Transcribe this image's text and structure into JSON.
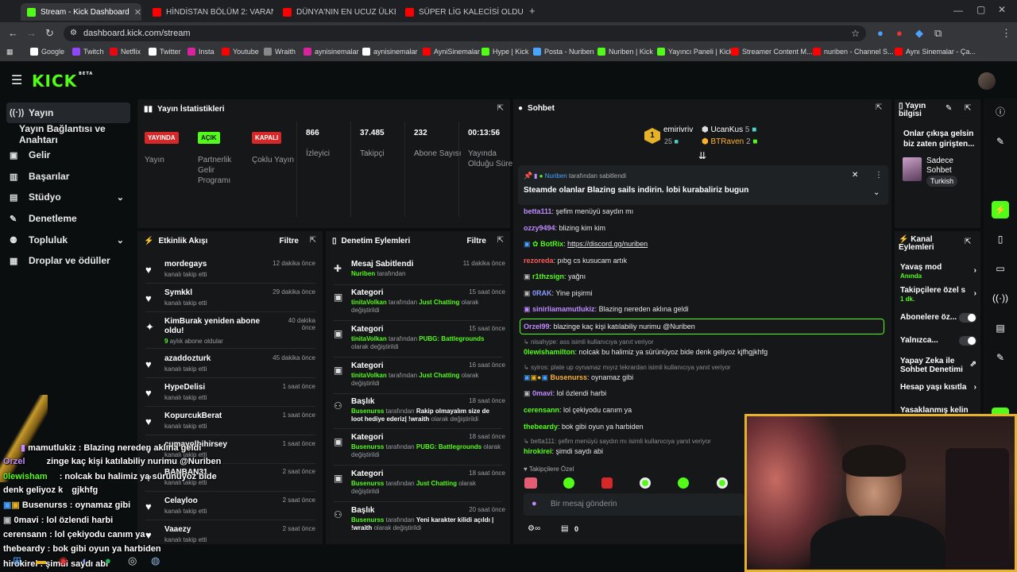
{
  "browser": {
    "tabs": [
      {
        "title": "Stream - Kick Dashboard",
        "active": true
      },
      {
        "title": "HİNDİSTAN BÖLÜM 2: VARANA",
        "active": false
      },
      {
        "title": "DÜNYA'NIN EN UCUZ ÜLKESİ V",
        "active": false
      },
      {
        "title": "SÜPER LİG KALECİSİ OLDUM ! |",
        "active": false
      }
    ],
    "url": "dashboard.kick.com/stream",
    "bookmarks": [
      "Google",
      "Twitch",
      "Netflix",
      "Twitter",
      "Insta",
      "Youtube",
      "Wraith",
      "aynisinemalar",
      "aynisinemalar",
      "AyniSinemalar",
      "Hype | Kick",
      "Posta - Nuriben",
      "Nuriben | Kick",
      "Yayıncı Paneli | Kick",
      "Streamer Content M...",
      "nuriben - Channel S...",
      "Aynı Sinemalar - Ça..."
    ]
  },
  "brand": {
    "logo": "KICK",
    "beta": "BETA",
    "accent": "#53fc18"
  },
  "sidebar": {
    "items": [
      {
        "label": "Yayın",
        "icon": "broadcast-icon"
      },
      {
        "label": "Yayın Bağlantısı ve Anahtarı"
      },
      {
        "label": "Gelir",
        "icon": "money-icon"
      },
      {
        "label": "Başarılar",
        "icon": "trophy-icon"
      },
      {
        "label": "Stüdyo",
        "icon": "studio-icon"
      },
      {
        "label": "Denetleme",
        "icon": "wrench-icon"
      },
      {
        "label": "Topluluk",
        "icon": "community-icon"
      },
      {
        "label": "Droplar ve ödüller",
        "icon": "gift-icon"
      }
    ]
  },
  "stats": {
    "title": "Yayın İstatistikleri",
    "items": [
      {
        "badge": "YAYINDA",
        "label": "Yayın"
      },
      {
        "badge": "AÇIK",
        "label": "Partnerlik Gelir Programı"
      },
      {
        "badge": "KAPALI",
        "label": "Çoklu Yayın"
      },
      {
        "value": "866",
        "label": "İzleyici"
      },
      {
        "value": "37.485",
        "label": "Takipçi"
      },
      {
        "value": "232",
        "label": "Abone Sayısı"
      },
      {
        "value": "00:13:56",
        "label": "Yayında Olduğu Süre"
      }
    ]
  },
  "activity": {
    "title": "Etkinlik Akışı",
    "filter": "Filtre",
    "items": [
      {
        "name": "mordegays",
        "sub": "kanalı takip etti",
        "time": "12 dakika önce"
      },
      {
        "name": "Symkkl",
        "sub": "kanalı takip etti",
        "time": "29 dakika önce"
      },
      {
        "name": "KimBurak yeniden abone oldu!",
        "sub_num": "9",
        "sub": "aylık abone oldular",
        "time": "40 dakika önce"
      },
      {
        "name": "azaddozturk",
        "sub": "kanalı takip etti",
        "time": "45 dakika önce"
      },
      {
        "name": "HypeDelisi",
        "sub": "kanalı takip etti",
        "time": "1 saat önce"
      },
      {
        "name": "KopurcukBerat",
        "sub": "kanalı takip etti",
        "time": "1 saat önce"
      },
      {
        "name": "cumayolbihirsey",
        "sub": "kanalı takip etti",
        "time": "1 saat önce"
      },
      {
        "name": "BANBAN31",
        "sub": "kanalı takip etti",
        "time": "2 saat önce"
      },
      {
        "name": "Celayloo",
        "sub": "kanalı takip etti",
        "time": "2 saat önce"
      },
      {
        "name": "Vaaezy",
        "sub": "kanalı takip etti",
        "time": "2 saat önce"
      }
    ]
  },
  "modactions": {
    "title": "Denetim Eylemleri",
    "filter": "Filtre",
    "items": [
      {
        "title": "Mesaj Sabitlendi",
        "time": "11 dakika önce",
        "user": "Nuriben",
        "mid": "tarafından",
        "rest": ""
      },
      {
        "title": "Kategori",
        "time": "15 saat önce",
        "user": "tinitaVolkan",
        "mid": "tarafından",
        "target": "Just Chatting",
        "rest": "olarak değiştirildi"
      },
      {
        "title": "Kategori",
        "time": "15 saat önce",
        "user": "tinitaVolkan",
        "mid": "tarafından",
        "target": "PUBG: Battlegrounds",
        "rest": "olarak değiştirildi"
      },
      {
        "title": "Kategori",
        "time": "16 saat önce",
        "user": "tinitaVolkan",
        "mid": "tarafından",
        "target": "Just Chatting",
        "rest": "olarak değiştirildi"
      },
      {
        "title": "Başlık",
        "time": "18 saat önce",
        "user": "Busenurss",
        "mid": "tarafından",
        "target": "Rakip olmayalım size de loot hediye ederiz| !wraith",
        "rest": "olarak değiştirildi"
      },
      {
        "title": "Kategori",
        "time": "18 saat önce",
        "user": "Busenurss",
        "mid": "tarafından",
        "target": "PUBG: Battlegrounds",
        "rest": "olarak değiştirildi"
      },
      {
        "title": "Kategori",
        "time": "18 saat önce",
        "user": "Busenurss",
        "mid": "tarafından",
        "target": "Just Chatting",
        "rest": "olarak değiştirildi"
      },
      {
        "title": "Başlık",
        "time": "20 saat önce",
        "user": "Busenurss",
        "mid": "tarafından",
        "target": "Yeni karakter kilidi açıldı | !wraith",
        "rest": "olarak değiştirildi"
      }
    ]
  },
  "chat": {
    "title": "Sohbet",
    "leaders": [
      {
        "rank": "1",
        "name": "emirivriv",
        "count": "25"
      },
      {
        "name": "UcanKus",
        "count": "5"
      },
      {
        "name": "BTRaven",
        "count": "2"
      }
    ],
    "pinned": {
      "by_user": "Nuriben",
      "by_text": "tarafından sabitlendi",
      "message": "Steamde olanlar Blazing sails indirin. lobi kurabaliriz bugun"
    },
    "messages": [
      {
        "user": "betta111",
        "color": "#c08cff",
        "text": "şefim menüyü saydın mı"
      },
      {
        "user": "ozzy9494",
        "color": "#c08cff",
        "text": "blizing kim kim"
      },
      {
        "user": "BotRix",
        "color": "#53fc18",
        "text": "https://discord.gg/nuriben"
      },
      {
        "user": "rezoreda",
        "color": "#ff5a5a",
        "text": "pıbg cs kusucam artık"
      },
      {
        "user": "r1thzsign",
        "color": "#53fc18",
        "text": "yağnı"
      },
      {
        "user": "0RAK",
        "color": "#8a9cff",
        "text": "Yine pişirmi"
      },
      {
        "user": "sinirliamamutlukiz",
        "color": "#c08cff",
        "text": "Blazing nereden aklına geldi"
      },
      {
        "user": "Orzel99",
        "color": "#c08cff",
        "text": "blazinge kaç kişi katılabiliy nurimu @Nuriben"
      },
      {
        "sys": "nisahype: ass isimli kullanıcıya yanıt veriyor"
      },
      {
        "user": "0lewishamilton",
        "color": "#53fc18",
        "text": "nolcak bu halimiz ya sürünüyoz bide denk geliyoz kjfhgjkhfg"
      },
      {
        "sys": "syiros: plate up oynamaz mıyız tekrardan isimli kullanıcıya yanıt veriyor"
      },
      {
        "user": "Busenurss",
        "color": "#ffb02e",
        "text": "oynamaz gibi"
      },
      {
        "user": "0mavi",
        "color": "#c08cff",
        "text": "lol özlendi harbi"
      },
      {
        "user": "cerensann",
        "color": "#53fc18",
        "text": "lol çekiyodu canım ya"
      },
      {
        "user": "thebeardy",
        "color": "#53fc18",
        "text": "bok gibi oyun ya harbiden"
      },
      {
        "sys": "betta111: şefim menüyü saydın mı isimli kullanıcıya yanıt veriyor"
      },
      {
        "user": "hirokirei",
        "color": "#53fc18",
        "text": "şimdi saydı abi"
      }
    ],
    "followers_label": "Takipçilere Özel",
    "input_placeholder": "Bir mesaj gönderin",
    "counter": "0"
  },
  "streaminfo": {
    "title": "Yayın bilgisi",
    "text": "Onlar çıkışa gelsin biz zaten girişten...",
    "category": "Sadece Sohbet",
    "language": "Turkish"
  },
  "channelactions": {
    "title": "Kanal Eylemleri",
    "items": [
      {
        "label": "Yavaş mod",
        "sub": "Anında"
      },
      {
        "label": "Takipçilere özel s",
        "sub": "1 dk."
      },
      {
        "label": "Abonelere öz..."
      },
      {
        "label": "Yalnızca..."
      },
      {
        "label": "Yapay Zeka ile Sohbet Denetimi"
      },
      {
        "label": "Hesap yaşı kısıtla"
      },
      {
        "label": "Yasaklanmış kelin"
      }
    ]
  },
  "overlay": {
    "lines": [
      "mamutlukiz : Blazing nereden aklına geldi",
      "Orzel",
      "zinge kaç kişi katılabiliy nurimu @Nuriben",
      "0lewisham",
      ": nolcak bu halimiz ya sürünüyoz bide",
      "denk geliyoz k",
      "gjkhfg",
      "Busenurss : oynamaz gibi",
      "0mavi : lol özlendi harbi",
      "cerensann : lol çekiyodu canım ya",
      "thebeardy : bok gibi oyun ya harbiden",
      "hirokirei : şimdi saydı abi"
    ]
  }
}
